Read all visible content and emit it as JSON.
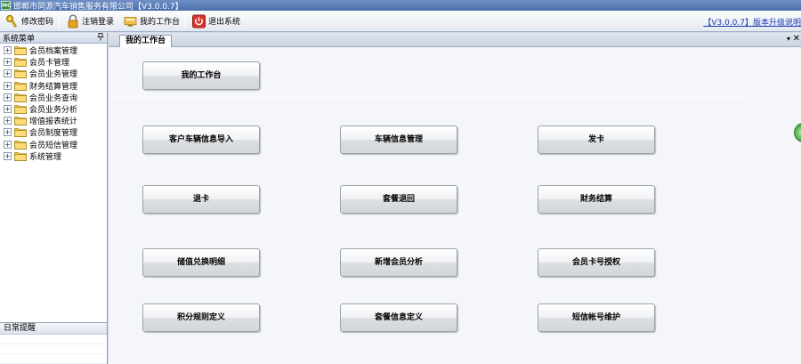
{
  "window": {
    "app_icon_text": "MC",
    "title": "邯郸市同源汽车销售服务有限公司【V3.0.0.7】"
  },
  "toolbar": {
    "change_password": "修改密码",
    "logout": "注销登录",
    "workbench": "我的工作台",
    "exit": "退出系统",
    "version_link": "【V3.0.0.7】版本升级说明"
  },
  "sidebar": {
    "header": "系统菜单",
    "pin": "ᵖ",
    "items": [
      {
        "label": "会员档案管理"
      },
      {
        "label": "会员卡管理"
      },
      {
        "label": "会员业务管理"
      },
      {
        "label": "财务结算管理"
      },
      {
        "label": "会员业务查询"
      },
      {
        "label": "会员业务分析"
      },
      {
        "label": "增值报表统计"
      },
      {
        "label": "会员制度管理"
      },
      {
        "label": "会员短信管理"
      },
      {
        "label": "系统管理"
      }
    ],
    "reminder_header": "日常提醒"
  },
  "tabs": {
    "active": "我的工作台",
    "dropdown": "▾",
    "close": "✕"
  },
  "workbench": {
    "top_button": "我的工作台",
    "buttons": [
      "客户车辆信息导入",
      "车辆信息管理",
      "发卡",
      "退卡",
      "套餐退回",
      "财务结算",
      "储值兑换明细",
      "新增会员分析",
      "会员卡号授权",
      "积分规则定义",
      "套餐信息定义",
      "短信帐号维护"
    ]
  },
  "icons": {
    "change_password": "key-icon",
    "logout": "lock-icon",
    "workbench": "workbench-icon",
    "exit": "power-icon",
    "tree_folder": "folder-icon"
  },
  "colors": {
    "title_bar": "#4a6fae",
    "exit_icon": "#d9352b",
    "link": "#1a3bb0"
  }
}
